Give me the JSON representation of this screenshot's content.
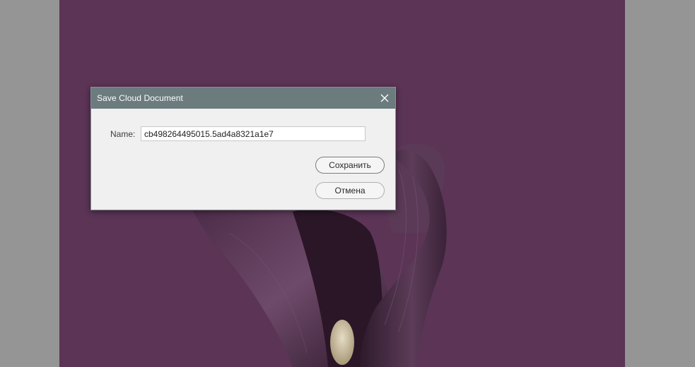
{
  "dialog": {
    "title": "Save Cloud Document",
    "name_label": "Name:",
    "name_value": "cb498264495015.5ad4a8321a1e7",
    "save_label": "Сохранить",
    "cancel_label": "Отмена"
  },
  "icons": {
    "close": "close-icon"
  },
  "colors": {
    "workspace": "#959595",
    "canvas": "#5b3456",
    "titlebar": "#6b7b7e",
    "dialog_bg": "#f0f0f0"
  }
}
